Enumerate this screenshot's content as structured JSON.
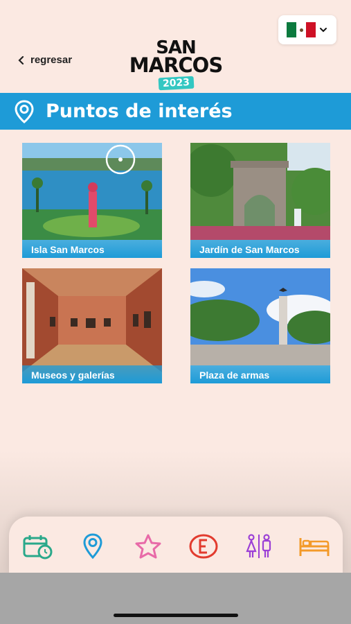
{
  "header": {
    "back_label": "regresar",
    "logo": {
      "line1": "SAN",
      "line2": "MARCOS",
      "line3": "2023"
    },
    "language": "Español (México)"
  },
  "section": {
    "title": "Puntos de interés",
    "icon": "location-pin-icon"
  },
  "places": [
    {
      "label": "Isla San Marcos"
    },
    {
      "label": "Jardín de San Marcos"
    },
    {
      "label": "Museos y galerías"
    },
    {
      "label": "Plaza de armas"
    }
  ],
  "bottom_nav": [
    {
      "icon": "calendar-clock-icon",
      "color": "#2aa88a"
    },
    {
      "icon": "location-pin-icon",
      "color": "#1e9bd7"
    },
    {
      "icon": "star-icon",
      "color": "#e86aa8"
    },
    {
      "icon": "entertainment-e-icon",
      "color": "#e23b2e"
    },
    {
      "icon": "restroom-icon",
      "color": "#9b3fd6"
    },
    {
      "icon": "bed-icon",
      "color": "#f39a2a"
    }
  ],
  "colors": {
    "accent": "#1e9bd7",
    "background": "#fbe9e2"
  }
}
